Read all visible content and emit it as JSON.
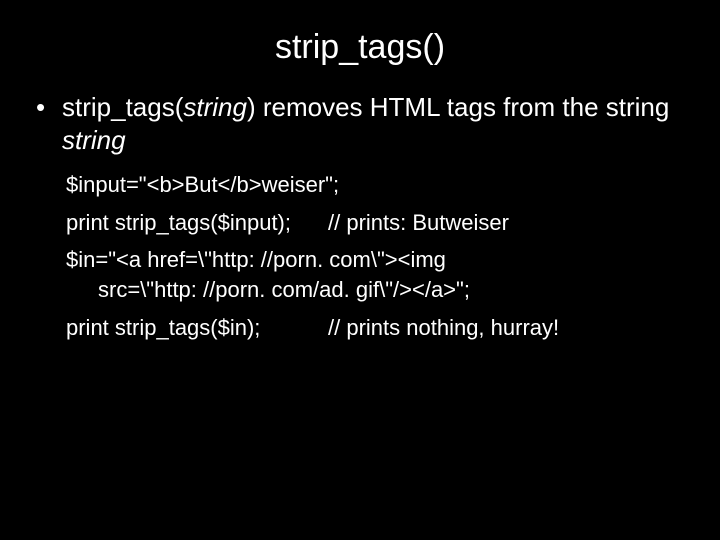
{
  "title": "strip_tags()",
  "bullet": {
    "dot": "•",
    "fn": "strip_tags(",
    "arg": "string",
    "rest": ") removes HTML tags from the string ",
    "tail": "string"
  },
  "code": {
    "l1": "$input=\"<b>But</b>weiser\";",
    "l2_left": "print strip_tags($input);",
    "l2_right": "// prints: Butweiser",
    "l3a": "$in=\"<a href=\\\"http: //porn. com\\\"><img",
    "l3b": "src=\\\"http: //porn. com/ad. gif\\\"/></a>\";",
    "l4_left": "print strip_tags($in);",
    "l4_right": "// prints nothing, hurray!"
  }
}
